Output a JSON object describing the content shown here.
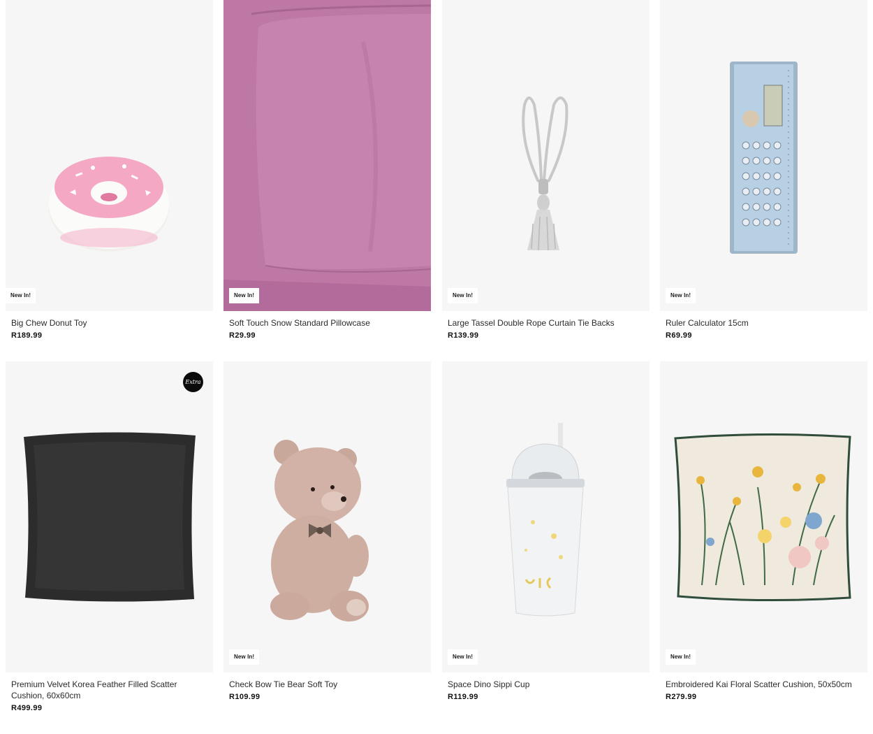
{
  "products": [
    {
      "name": "Big Chew Donut Toy",
      "price": "R189.99",
      "badge": "New In!",
      "icon": "donut-toy"
    },
    {
      "name": "Soft Touch Snow Standard Pillowcase",
      "price": "R29.99",
      "badge": "New In!",
      "icon": "pillowcase"
    },
    {
      "name": "Large Tassel Double Rope Curtain Tie Backs",
      "price": "R139.99",
      "badge": "New In!",
      "icon": "tassel-tie-back"
    },
    {
      "name": "Ruler Calculator 15cm",
      "price": "R69.99",
      "badge": "New In!",
      "icon": "ruler-calculator"
    },
    {
      "name": "Premium Velvet Korea Feather Filled Scatter Cushion, 60x60cm",
      "price": "R499.99",
      "badge": "",
      "extra_label": "Extra",
      "icon": "velvet-cushion"
    },
    {
      "name": "Check Bow Tie Bear Soft Toy",
      "price": "R109.99",
      "badge": "New In!",
      "icon": "teddy-bear"
    },
    {
      "name": "Space Dino Sippi Cup",
      "price": "R119.99",
      "badge": "New In!",
      "icon": "sippy-cup"
    },
    {
      "name": "Embroidered Kai Floral Scatter Cushion, 50x50cm",
      "price": "R279.99",
      "badge": "New In!",
      "icon": "floral-cushion"
    }
  ],
  "colors": {
    "image_bg": "#f6f6f6",
    "pillow_pink": "#c07aa9",
    "cushion_dark": "#2c2c2c",
    "badge_bg": "#ffffff"
  }
}
